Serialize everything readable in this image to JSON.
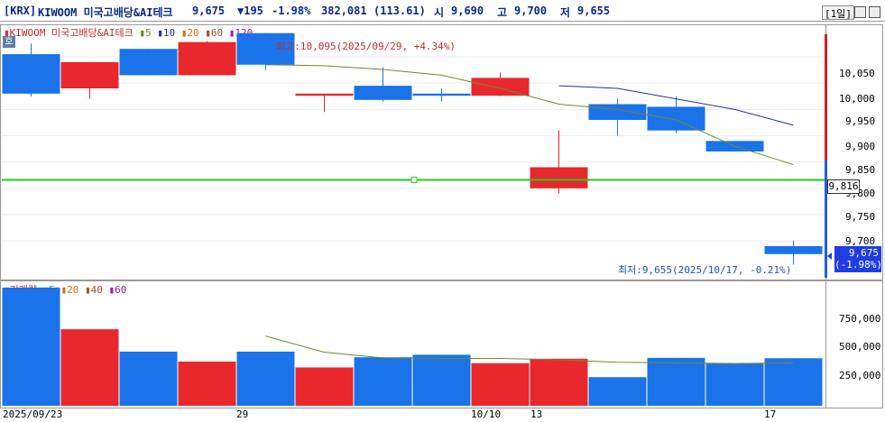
{
  "title": {
    "market": "[KRX]",
    "name": "KIWOOM 미국고배당&AI테크",
    "price": "9,675",
    "change": "▼195",
    "change_pct": "-1.98%",
    "volume": "382,081",
    "amount": "(113.61)",
    "open_label": "시",
    "open": "9,690",
    "high_label": "고",
    "high": "9,700",
    "low_label": "저",
    "low": "9,655",
    "period": "[1일]"
  },
  "colors": {
    "up": "#e8282c",
    "down": "#1a73e8",
    "ma5": "#6f8b2b",
    "ma10": "#2b2fa8",
    "crosshair": "#22cc22"
  },
  "price_panel": {
    "side_tab": "호",
    "legend": {
      "name": "KIWOOM 미국고배당&AI테크",
      "ma": [
        "5",
        "10",
        "20",
        "60",
        "120"
      ]
    },
    "y_ticks": [
      "10,050",
      "10,000",
      "9,950",
      "9,900",
      "9,850",
      "9,800",
      "9,750",
      "9,700"
    ],
    "high_annotation": "최고:10,095(2025/09/29, +4.34%)",
    "low_annotation": "최저:9,655(2025/10/17, -0.21%)",
    "crosshair_value": "9,816",
    "last_price_label": "9,675",
    "last_change_label": "(-1.98%)"
  },
  "volume_panel": {
    "legend": {
      "name": "거래량",
      "ma": [
        "5",
        "20",
        "40",
        "60"
      ]
    },
    "y_ticks": [
      "750,000",
      "500,000",
      "250,000"
    ]
  },
  "x_labels": [
    "2025/09/23",
    "29",
    "10/10",
    "13",
    "17"
  ],
  "chart_data": {
    "type": "candlestick",
    "y_range": [
      9630,
      10110
    ],
    "volume_range": [
      0,
      1000000
    ],
    "candles": [
      {
        "open": 10055,
        "high": 10075,
        "low": 9975,
        "close": 9980,
        "volume": 950000
      },
      {
        "open": 9990,
        "high": 10040,
        "low": 9970,
        "close": 10040,
        "volume": 615000
      },
      {
        "open": 10065,
        "high": 10065,
        "low": 10015,
        "close": 10015,
        "volume": 435000
      },
      {
        "open": 10015,
        "high": 10080,
        "low": 10015,
        "close": 10078,
        "volume": 355000
      },
      {
        "open": 10095,
        "high": 10095,
        "low": 10025,
        "close": 10035,
        "volume": 435000
      },
      {
        "open": 9976,
        "high": 9980,
        "low": 9945,
        "close": 9980,
        "volume": 308000
      },
      {
        "open": 9995,
        "high": 10030,
        "low": 9965,
        "close": 9968,
        "volume": 390000
      },
      {
        "open": 9980,
        "high": 9990,
        "low": 9965,
        "close": 9976,
        "volume": 410000
      },
      {
        "open": 9976,
        "high": 10020,
        "low": 9975,
        "close": 10010,
        "volume": 342000
      },
      {
        "open": 9800,
        "high": 9910,
        "low": 9790,
        "close": 9840,
        "volume": 378000
      },
      {
        "open": 9960,
        "high": 9970,
        "low": 9900,
        "close": 9930,
        "volume": 230000
      },
      {
        "open": 9955,
        "high": 9975,
        "low": 9905,
        "close": 9910,
        "volume": 385000
      },
      {
        "open": 9890,
        "high": 9890,
        "low": 9870,
        "close": 9870,
        "volume": 340000
      },
      {
        "open": 9690,
        "high": 9700,
        "low": 9655,
        "close": 9675,
        "volume": 382081
      }
    ],
    "ma5": [
      null,
      null,
      null,
      null,
      10035,
      10033,
      10026,
      10015,
      9990,
      9960,
      9950,
      9930,
      9880,
      9845
    ],
    "ma10": [
      null,
      null,
      null,
      null,
      null,
      null,
      null,
      null,
      null,
      9995,
      9990,
      9970,
      9950,
      9920
    ],
    "volume_ma5": [
      null,
      null,
      null,
      null,
      560000,
      430000,
      385000,
      380000,
      380000,
      370000,
      350000,
      345000,
      340000,
      345000
    ]
  }
}
